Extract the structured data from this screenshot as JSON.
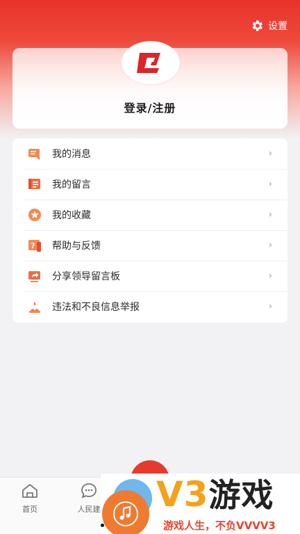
{
  "header": {
    "settings_label": "设置"
  },
  "profile": {
    "login_label": "登录/注册"
  },
  "menu": {
    "items": [
      {
        "label": "我的消息",
        "icon": "message-icon"
      },
      {
        "label": "我的留言",
        "icon": "comment-icon"
      },
      {
        "label": "我的收藏",
        "icon": "star-icon"
      },
      {
        "label": "帮助与反馈",
        "icon": "help-icon"
      },
      {
        "label": "分享领导留言板",
        "icon": "share-icon"
      },
      {
        "label": "违法和不良信息举报",
        "icon": "report-icon"
      }
    ],
    "chevron": "›"
  },
  "tabbar": {
    "tabs": [
      {
        "label": "首页",
        "icon": "home-icon"
      },
      {
        "label": "人民建",
        "icon": "chat-icon"
      }
    ]
  },
  "watermark": {
    "title_v3": "V3",
    "title_rest": "游戏",
    "slogan": "游戏人生，不负VVVV3"
  },
  "colors": {
    "brand_red": "#e63a2e",
    "icon_orange": "#f36b3f",
    "watermark_gold": "#f5a21b"
  }
}
